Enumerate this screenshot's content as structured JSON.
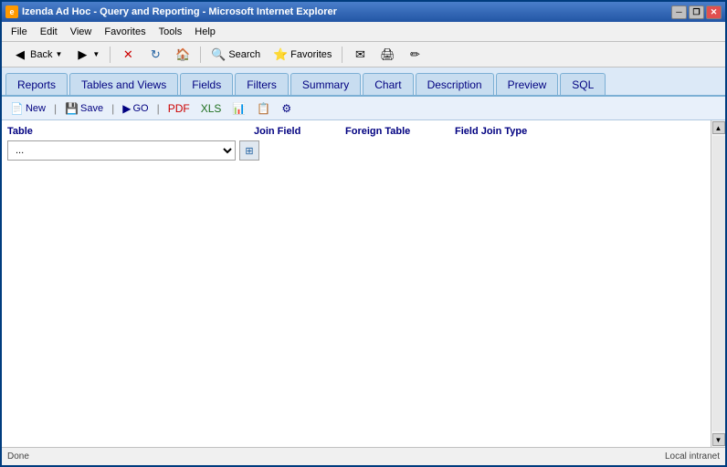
{
  "window": {
    "title": "Izenda Ad Hoc - Query and Reporting - Microsoft Internet Explorer",
    "icon": "IE"
  },
  "menubar": {
    "items": [
      "File",
      "Edit",
      "View",
      "Favorites",
      "Tools",
      "Help"
    ]
  },
  "toolbar": {
    "back_label": "Back",
    "search_label": "Search",
    "favorites_label": "Favorites"
  },
  "tabs": [
    {
      "label": "Reports",
      "active": false
    },
    {
      "label": "Tables and Views",
      "active": false
    },
    {
      "label": "Fields",
      "active": false
    },
    {
      "label": "Filters",
      "active": false
    },
    {
      "label": "Summary",
      "active": false
    },
    {
      "label": "Chart",
      "active": false
    },
    {
      "label": "Description",
      "active": false
    },
    {
      "label": "Preview",
      "active": false
    },
    {
      "label": "SQL",
      "active": false
    }
  ],
  "action_bar": {
    "new_label": "New",
    "save_label": "Save",
    "go_label": "GO"
  },
  "joins": {
    "col_table": "Table",
    "col_join_field": "Join Field",
    "col_foreign_table": "Foreign Table",
    "col_field_join_type": "Field Join Type",
    "table_placeholder": "..."
  },
  "status_bar": {
    "text": "Done",
    "zone": "Local intranet"
  }
}
